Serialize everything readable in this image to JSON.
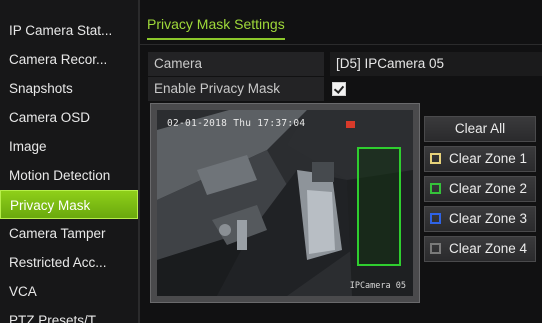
{
  "sidebar": {
    "items": [
      {
        "label": "IP Camera Stat..."
      },
      {
        "label": "Camera Recor..."
      },
      {
        "label": "Snapshots"
      },
      {
        "label": "Camera OSD"
      },
      {
        "label": "Image"
      },
      {
        "label": "Motion Detection"
      },
      {
        "label": "Privacy Mask",
        "active": true
      },
      {
        "label": "Camera Tamper"
      },
      {
        "label": "Restricted Acc..."
      },
      {
        "label": "VCA"
      },
      {
        "label": "PTZ Presets/T..."
      }
    ]
  },
  "page": {
    "tab_title": "Privacy Mask Settings"
  },
  "form": {
    "camera_label": "Camera",
    "camera_value": "[D5] IPCamera 05",
    "enable_label": "Enable Privacy Mask",
    "enable_checked": true
  },
  "preview": {
    "osd_datetime": "02-01-2018 Thu 17:37:04",
    "osd_camera_name": "IPCamera 05"
  },
  "buttons": {
    "clear_all": "Clear All",
    "zones": [
      {
        "label": "Clear Zone 1",
        "color": "#e7d27a"
      },
      {
        "label": "Clear Zone 2",
        "color": "#35c23a"
      },
      {
        "label": "Clear Zone 3",
        "color": "#2f63e6"
      },
      {
        "label": "Clear Zone 4",
        "color": "#7a7a7a"
      }
    ]
  },
  "colors": {
    "accent": "#8cc72b",
    "active_item": "#7bbd14"
  }
}
